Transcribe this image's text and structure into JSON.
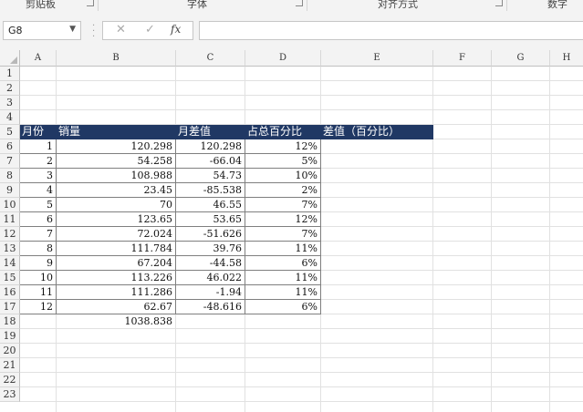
{
  "ribbon": {
    "groups": [
      "剪贴板",
      "字体",
      "对齐方式",
      "数字"
    ]
  },
  "formula_bar": {
    "name_box": "G8",
    "cancel_icon": "✕",
    "enter_icon": "✓",
    "fx_label": "fx",
    "formula": ""
  },
  "columns": [
    "A",
    "B",
    "C",
    "D",
    "E",
    "F",
    "G",
    "H"
  ],
  "rows": [
    "1",
    "2",
    "3",
    "4",
    "5",
    "6",
    "7",
    "8",
    "9",
    "10",
    "11",
    "12",
    "13",
    "14",
    "15",
    "16",
    "17",
    "18",
    "19",
    "20",
    "21",
    "22",
    "23"
  ],
  "table": {
    "headers": [
      "月份",
      "销量",
      "月差值",
      "占总百分比",
      "差值（百分比）"
    ],
    "rows": [
      [
        "1",
        "120.298",
        "120.298",
        "12%"
      ],
      [
        "2",
        "54.258",
        "-66.04",
        "5%"
      ],
      [
        "3",
        "108.988",
        "54.73",
        "10%"
      ],
      [
        "4",
        "23.45",
        "-85.538",
        "2%"
      ],
      [
        "5",
        "70",
        "46.55",
        "7%"
      ],
      [
        "6",
        "123.65",
        "53.65",
        "12%"
      ],
      [
        "7",
        "72.024",
        "-51.626",
        "7%"
      ],
      [
        "8",
        "111.784",
        "39.76",
        "11%"
      ],
      [
        "9",
        "67.204",
        "-44.58",
        "6%"
      ],
      [
        "10",
        "113.226",
        "46.022",
        "11%"
      ],
      [
        "11",
        "111.286",
        "-1.94",
        "11%"
      ],
      [
        "12",
        "62.67",
        "-48.616",
        "6%"
      ]
    ],
    "total": "1038.838"
  },
  "colors": {
    "header_fill": "#203864",
    "header_text": "#ffffff"
  }
}
